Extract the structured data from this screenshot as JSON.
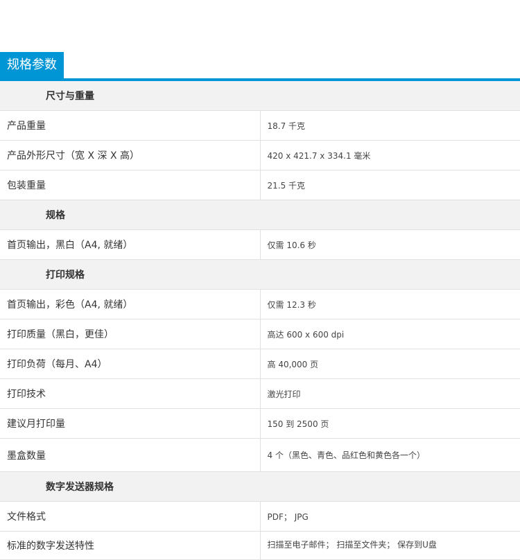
{
  "header": {
    "title": "规格参数"
  },
  "sections": [
    {
      "title": "尺寸与重量",
      "rows": [
        {
          "label": "产品重量",
          "value": "18.7 千克"
        },
        {
          "label": "产品外形尺寸（宽 X 深 X 高）",
          "value": "420 x 421.7 x 334.1 毫米"
        },
        {
          "label": "包装重量",
          "value": "21.5 千克"
        }
      ]
    },
    {
      "title": "规格",
      "rows": [
        {
          "label": "首页输出，黑白（A4, 就绪）",
          "value": "仅需 10.6 秒"
        }
      ]
    },
    {
      "title": "打印规格",
      "rows": [
        {
          "label": "首页输出，彩色（A4, 就绪）",
          "value": "仅需 12.3 秒"
        },
        {
          "label": "打印质量（黑白，更佳）",
          "value": "高达 600 x 600 dpi"
        },
        {
          "label": "打印负荷（每月、A4）",
          "value": "高 40,000 页"
        },
        {
          "label": "打印技术",
          "value": "激光打印"
        },
        {
          "label": "建议月打印量",
          "value": "150 到 2500 页"
        },
        {
          "label": "墨盒数量",
          "value": "4 个（黑色、青色、品红色和黄色各一个）"
        }
      ]
    },
    {
      "title": "数字发送器规格",
      "rows": [
        {
          "label": "文件格式",
          "value": "PDF； JPG"
        },
        {
          "label": "标准的数字发送特性",
          "value": "扫描至电子邮件； 扫描至文件夹； 保存到U盘"
        }
      ]
    }
  ]
}
